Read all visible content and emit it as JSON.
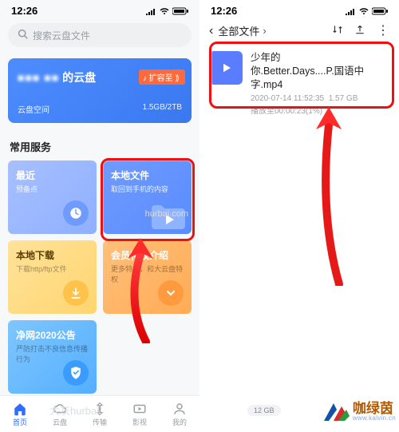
{
  "status": {
    "time": "12:26",
    "signal": "signal-icon",
    "wifi": "wifi-icon",
    "battery": "battery-icon"
  },
  "left": {
    "search_placeholder": "搜索云盘文件",
    "storage": {
      "owner_blur": "的云盘",
      "expand_label": "扩容至",
      "space_label": "云盘空间",
      "usage": "1.5GB/2TB"
    },
    "section_label": "常用服务",
    "tiles": {
      "recent": {
        "title": "最近",
        "sub": "预备点"
      },
      "local": {
        "title": "本地文件",
        "sub": "取回到手机的内容"
      },
      "download": {
        "title": "本地下载",
        "sub": "下载http/ftp文件"
      },
      "member": {
        "title": "会员特权介绍",
        "sub": "更多特权，和大云盘特权"
      },
      "notice": {
        "title": "净网2020公告",
        "sub": "严防打击不良信息传播行为"
      }
    },
    "tabs": {
      "home": "首页",
      "cloud": "云盘",
      "transfer": "传输",
      "video": "影视",
      "me": "我的"
    },
    "watermark1": "hurbai.com",
    "watermark2": "大灰hurbai"
  },
  "right": {
    "breadcrumb_root": "全部文件",
    "file": {
      "name_line1": "少年的",
      "name_line2": "你.Better.Days....P.国语中字.mp4",
      "date": "2020-07-14 11:52:35",
      "size": "1.57 GB",
      "progress": "播放至00:00:23(1%)"
    },
    "storage_pill": "12 GB"
  },
  "branding": {
    "cn": "咖绿茵",
    "url": "www.kalvin.cn"
  }
}
